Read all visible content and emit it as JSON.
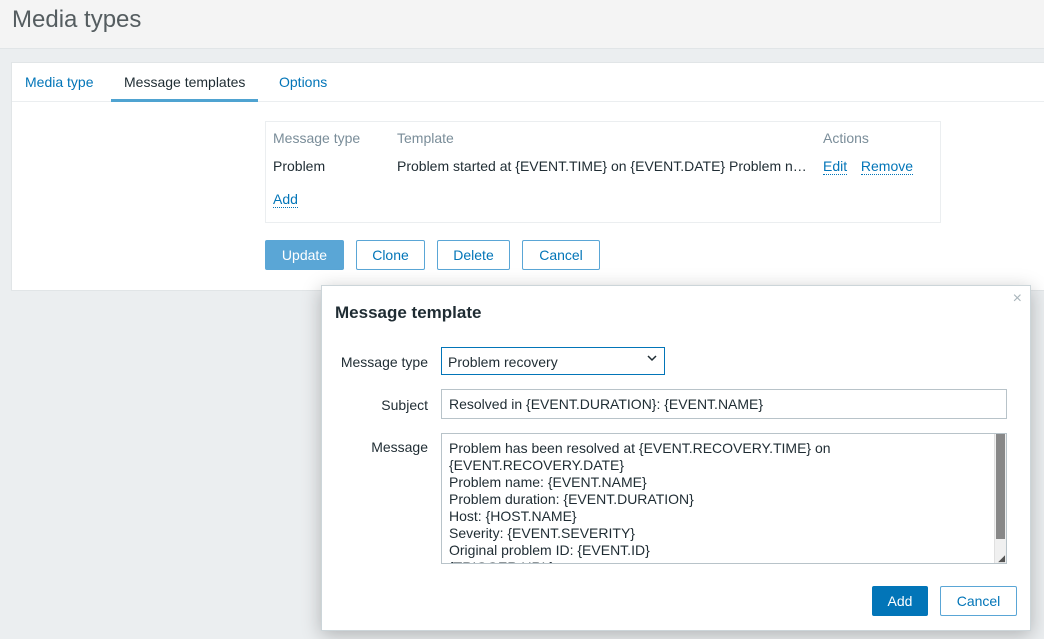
{
  "page": {
    "title": "Media types"
  },
  "tabs": [
    {
      "label": "Media type"
    },
    {
      "label": "Message templates"
    },
    {
      "label": "Options"
    }
  ],
  "templates_table": {
    "headers": {
      "type": "Message type",
      "template": "Template",
      "actions": "Actions"
    },
    "rows": [
      {
        "type": "Problem",
        "template": "Problem started at {EVENT.TIME} on {EVENT.DATE} Problem name: {EVENT.NAME}",
        "edit": "Edit",
        "remove": "Remove"
      }
    ],
    "add_label": "Add"
  },
  "form_buttons": {
    "update": "Update",
    "clone": "Clone",
    "delete": "Delete",
    "cancel": "Cancel"
  },
  "dialog": {
    "title": "Message template",
    "close_icon": "×",
    "message_type_label": "Message type",
    "message_type_value": "Problem recovery",
    "subject_label": "Subject",
    "subject_value": "Resolved in {EVENT.DURATION}: {EVENT.NAME}",
    "message_label": "Message",
    "message_value": "Problem has been resolved at {EVENT.RECOVERY.TIME} on\n{EVENT.RECOVERY.DATE}\nProblem name: {EVENT.NAME}\nProblem duration: {EVENT.DURATION}\nHost: {HOST.NAME}\nSeverity: {EVENT.SEVERITY}\nOriginal problem ID: {EVENT.ID}\n{TRIGGER.URL}",
    "add_button": "Add",
    "cancel_button": "Cancel"
  },
  "colors": {
    "link": "#0275b8",
    "primary_button": "#5aa6d6",
    "dialog_primary": "#0275b8"
  }
}
